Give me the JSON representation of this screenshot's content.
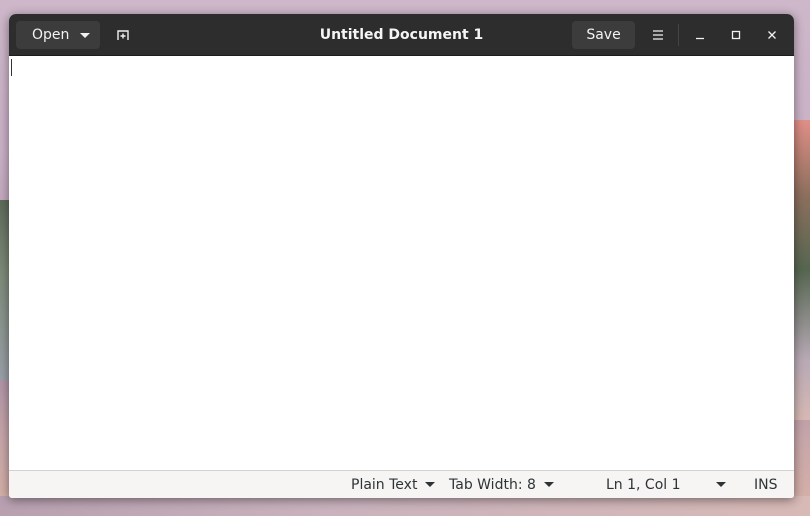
{
  "window": {
    "title": "Untitled Document 1"
  },
  "headerbar": {
    "open_label": "Open",
    "save_label": "Save",
    "icons": {
      "new_tab": "new-tab-icon",
      "menu": "hamburger-menu-icon",
      "minimize": "minimize-icon",
      "maximize": "maximize-icon",
      "close": "close-icon"
    }
  },
  "editor": {
    "content": ""
  },
  "statusbar": {
    "language": "Plain Text",
    "tab_width": "Tab Width: 8",
    "cursor_position": "Ln 1, Col 1",
    "mode": "INS"
  },
  "colors": {
    "headerbar_bg": "#2d2d2d",
    "button_bg": "#3c3c3c",
    "statusbar_bg": "#f6f5f4"
  }
}
